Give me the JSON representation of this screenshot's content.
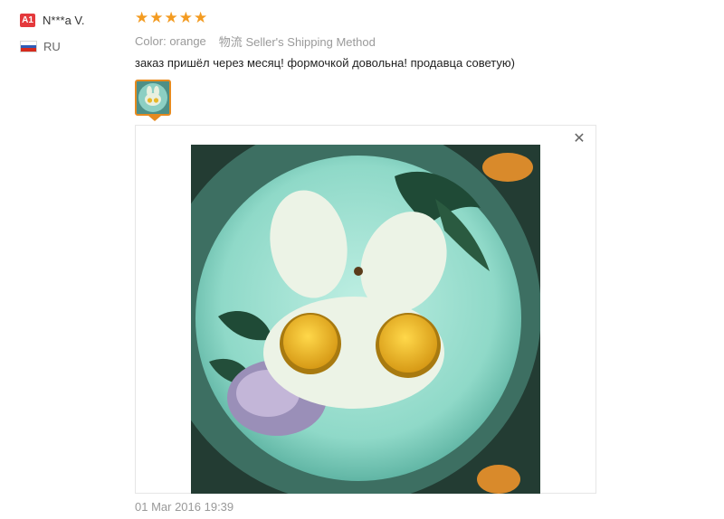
{
  "review": {
    "user": {
      "level": "A1",
      "name": "N***a V.",
      "country": "RU"
    },
    "rating": 5,
    "meta": {
      "color_label": "Color:",
      "color_value": "orange",
      "shipping_label": "物流",
      "shipping_value": "Seller's Shipping Method"
    },
    "text": "заказ пришёл через месяц! формочкой довольна! продавца советую)",
    "date": "01 Mar 2016 19:39"
  },
  "viewer": {
    "close_icon": "close-icon",
    "photo_alt": "egg-bunny-mold-on-plate"
  },
  "colors": {
    "star": "#f39b21",
    "badge": "#e4393c",
    "thumb_border": "#e68a1f"
  }
}
